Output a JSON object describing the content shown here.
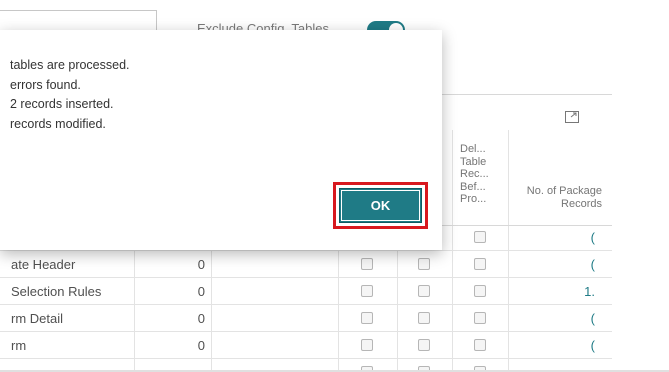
{
  "toolbar": {
    "exclude_config_label": "Exclude Config. Tables",
    "exclude_config_on": true
  },
  "grid": {
    "header_del": "Del...\nTable\nRec...\nBef...\nPro...",
    "header_pkg": "No. of Package\nRecords",
    "rows": [
      {
        "name": "",
        "count": "",
        "records": "("
      },
      {
        "name": "ate Header",
        "count": "0",
        "records": "("
      },
      {
        "name": "Selection Rules",
        "count": "0",
        "records": "1."
      },
      {
        "name": "rm Detail",
        "count": "0",
        "records": "("
      },
      {
        "name": "rm",
        "count": "0",
        "records": "("
      }
    ]
  },
  "dialog": {
    "line1": "tables are processed.",
    "line2": "errors found.",
    "line3": "2 records inserted.",
    "line4": "records modified.",
    "ok_label": "OK"
  },
  "colors": {
    "accent": "#1f7b86",
    "highlight_frame": "#d7181f"
  }
}
